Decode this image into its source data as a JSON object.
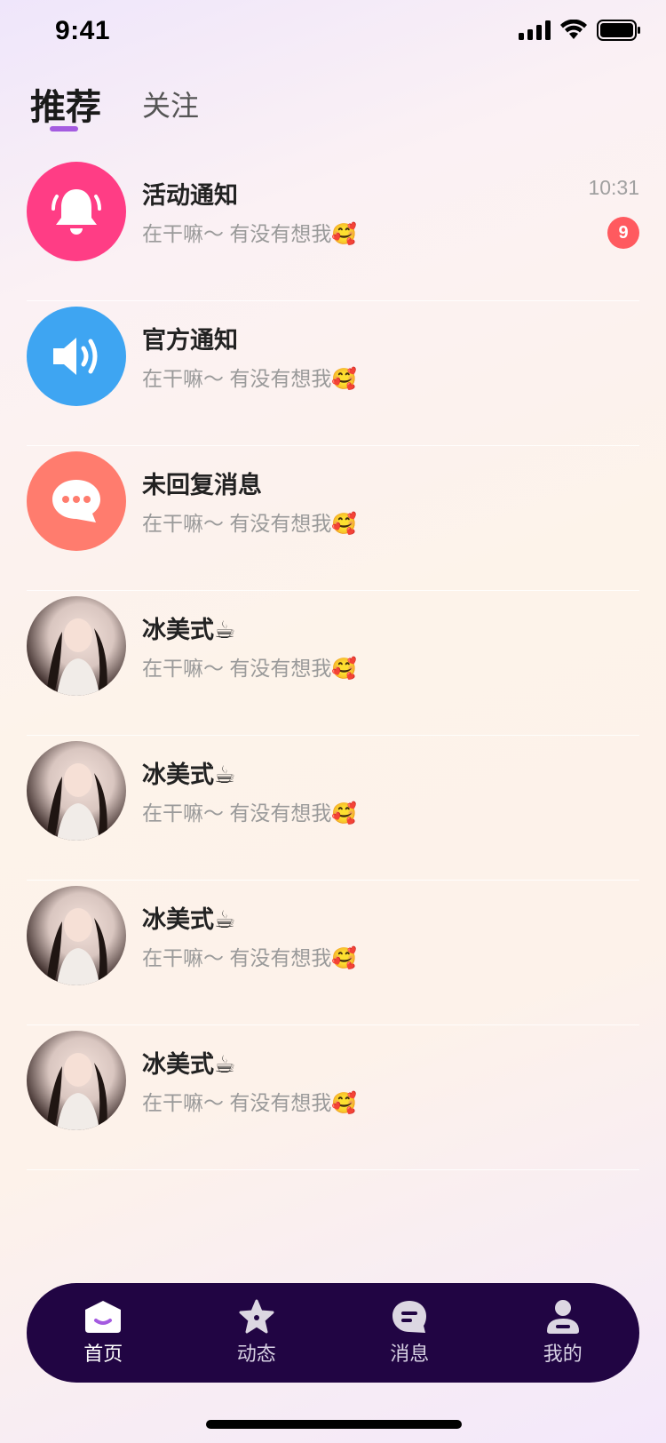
{
  "status_bar": {
    "time": "9:41"
  },
  "tabs": [
    {
      "label": "推荐",
      "active": true
    },
    {
      "label": "关注",
      "active": false
    }
  ],
  "conversations": [
    {
      "title": "活动通知",
      "preview": "在干嘛～ 有没有想我🥰",
      "time": "10:31",
      "badge": "9",
      "icon": "bell-icon",
      "color": "#ff3d85"
    },
    {
      "title": "官方通知",
      "preview": "在干嘛～ 有没有想我🥰",
      "icon": "speaker-icon",
      "color": "#3ea5f2"
    },
    {
      "title": "未回复消息",
      "preview": "在干嘛～ 有没有想我🥰",
      "icon": "chat-bubble-icon",
      "color": "#ff7c6e"
    },
    {
      "title": "冰美式☕",
      "preview": "在干嘛～ 有没有想我🥰",
      "icon": "user-avatar"
    },
    {
      "title": "冰美式☕",
      "preview": "在干嘛～ 有没有想我🥰",
      "icon": "user-avatar"
    },
    {
      "title": "冰美式☕",
      "preview": "在干嘛～ 有没有想我🥰",
      "icon": "user-avatar"
    },
    {
      "title": "冰美式☕",
      "preview": "在干嘛～ 有没有想我🥰",
      "icon": "user-avatar"
    }
  ],
  "bottom_nav": [
    {
      "label": "首页",
      "icon": "home-icon",
      "active": true
    },
    {
      "label": "动态",
      "icon": "star-icon",
      "active": false
    },
    {
      "label": "消息",
      "icon": "message-icon",
      "active": false
    },
    {
      "label": "我的",
      "icon": "profile-icon",
      "active": false
    }
  ],
  "colors": {
    "nav_bg": "#210543",
    "accent": "#a45be0",
    "badge": "#ff5a5f"
  }
}
